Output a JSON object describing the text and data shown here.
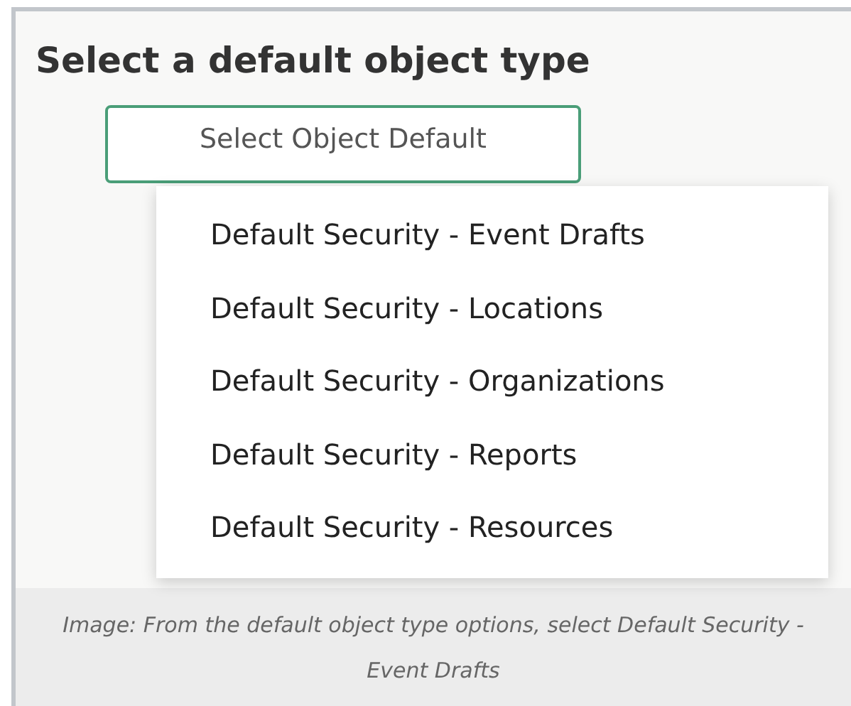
{
  "title": "Select a default object type",
  "dropdown": {
    "label": "Select Object Default"
  },
  "menu": {
    "items": [
      {
        "label": "Default Security - Event Drafts"
      },
      {
        "label": "Default Security - Locations"
      },
      {
        "label": "Default Security - Organizations"
      },
      {
        "label": "Default Security - Reports"
      },
      {
        "label": "Default Security - Resources"
      }
    ]
  },
  "caption": "Image: From the default object type options, select Default Security - Event Drafts"
}
